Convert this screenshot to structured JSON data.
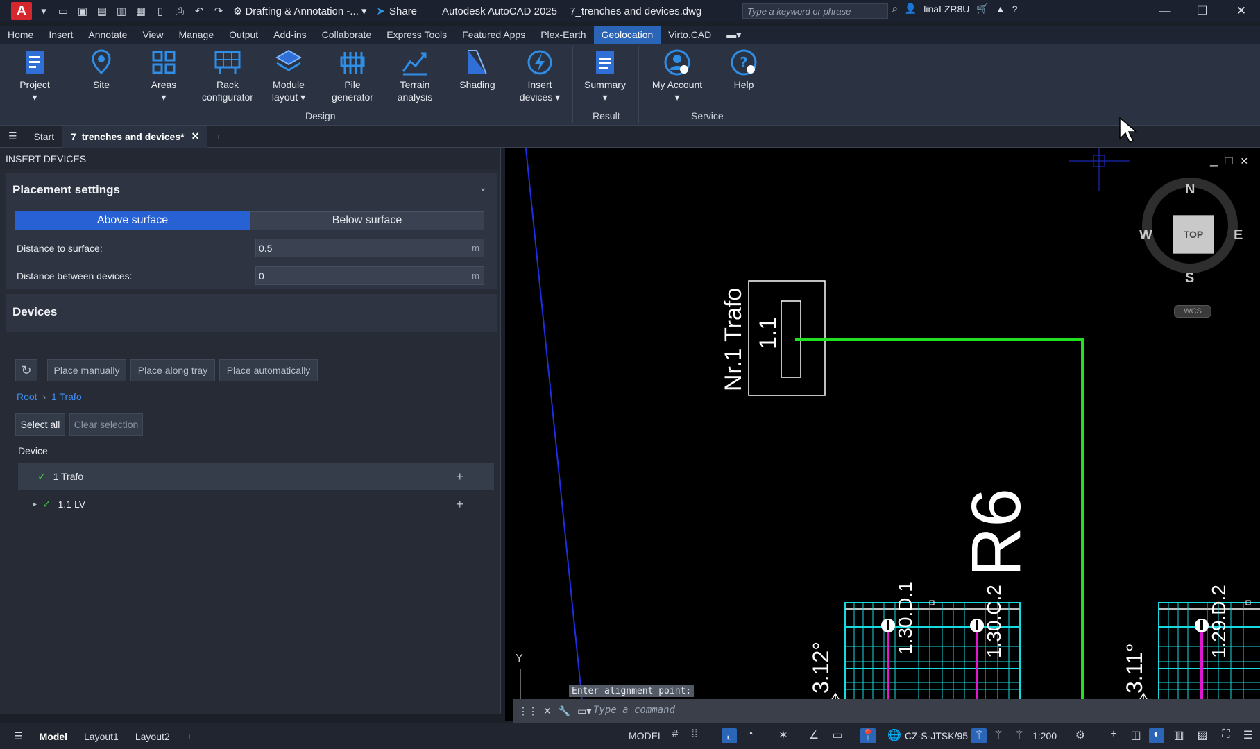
{
  "titlebar": {
    "app_logo": "A",
    "workspace": "Drafting & Annotation -...",
    "share": "Share",
    "app_title": "Autodesk AutoCAD 2025",
    "file_name": "7_trenches and devices.dwg",
    "search_placeholder": "Type a keyword or phrase",
    "user": "linaLZR8U"
  },
  "ribbon_tabs": [
    "Home",
    "Insert",
    "Annotate",
    "View",
    "Manage",
    "Output",
    "Add-ins",
    "Collaborate",
    "Express Tools",
    "Featured Apps",
    "Plex-Earth",
    "Geolocation",
    "Virto.CAD"
  ],
  "ribbon": {
    "buttons": {
      "project": "Project",
      "site": "Site",
      "areas": "Areas",
      "rack_1": "Rack",
      "rack_2": "configurator",
      "module_1": "Module",
      "module_2": "layout",
      "pile_1": "Pile",
      "pile_2": "generator",
      "terrain_1": "Terrain",
      "terrain_2": "analysis",
      "shading": "Shading",
      "insert_1": "Insert",
      "insert_2": "devices",
      "summary": "Summary",
      "account": "My Account",
      "help": "Help"
    },
    "groups": {
      "design": "Design",
      "result": "Result",
      "service": "Service"
    }
  },
  "doc_tabs": {
    "start": "Start",
    "active": "7_trenches and devices*"
  },
  "palette": {
    "title": "INSERT DEVICES",
    "placement": {
      "title": "Placement settings",
      "above": "Above surface",
      "below": "Below surface",
      "distance_surface_label": "Distance to surface:",
      "distance_surface_value": "0.5",
      "distance_devices_label": "Distance between devices:",
      "distance_devices_value": "0",
      "unit": "m"
    },
    "devices": {
      "title": "Devices",
      "place_manually": "Place manually",
      "place_along_tray": "Place along tray",
      "place_automatically": "Place automatically",
      "breadcrumb_root": "Root",
      "breadcrumb_current": "1 Trafo",
      "select_all": "Select all",
      "clear_selection": "Clear selection",
      "column_header": "Device",
      "rows": [
        {
          "label": "1 Trafo"
        },
        {
          "label": "1.1 LV"
        }
      ]
    }
  },
  "drawing": {
    "compass": {
      "n": "N",
      "s": "S",
      "e": "E",
      "w": "W",
      "top": "TOP",
      "wcs": "WCS"
    },
    "texts": {
      "trafo": "Nr.1 Trafo",
      "trafo_num": "1.1",
      "r6": "R6",
      "d1": "1.30.D.1",
      "c2": "1.30.C.2",
      "d2": "1.29.D.2",
      "angle1": "3.12°",
      "angle2": "3.11°",
      "y_axis": "Y"
    },
    "command_prompt": "Enter alignment point:",
    "command_placeholder": "Type a command"
  },
  "statusbar": {
    "tabs": [
      "Model",
      "Layout1",
      "Layout2"
    ],
    "model": "MODEL",
    "coord_system": "CZ-S-JTSK/95",
    "scale": "1:200"
  }
}
